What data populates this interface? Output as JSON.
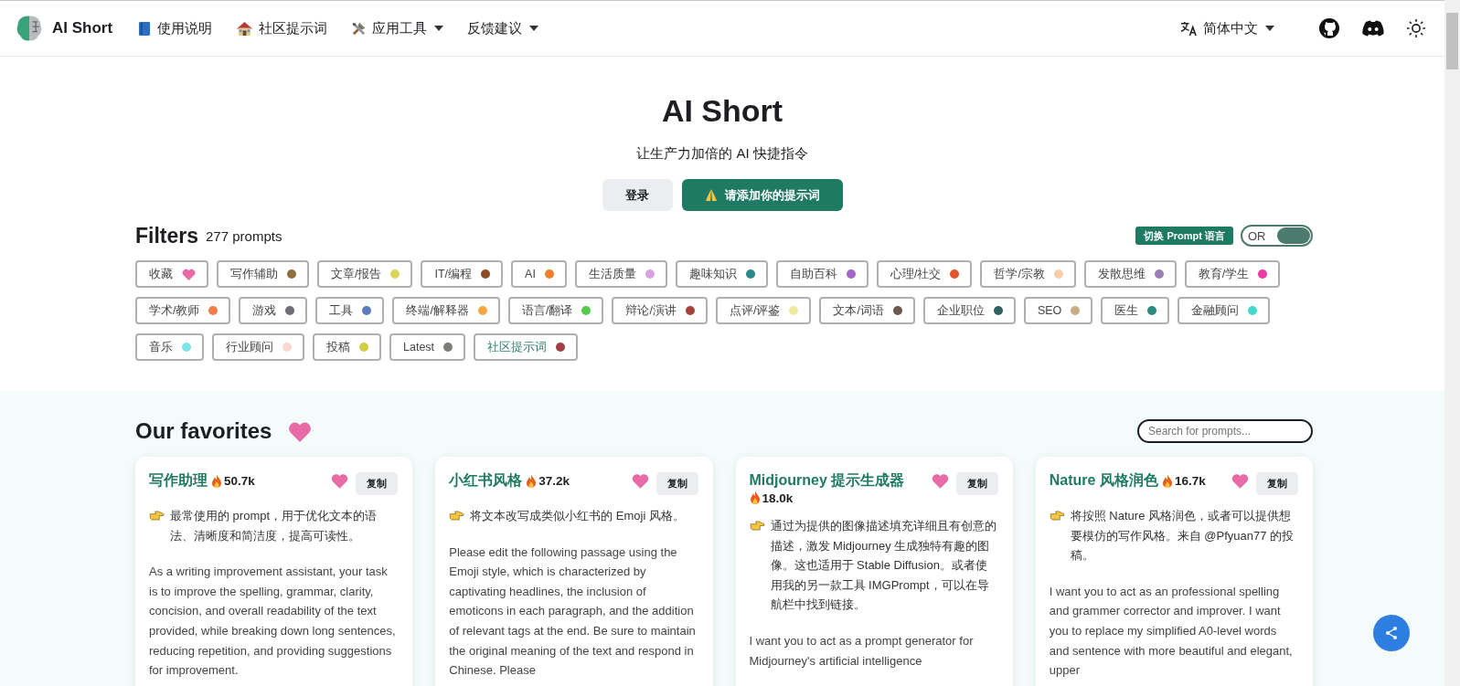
{
  "nav": {
    "brand": "AI Short",
    "links": [
      {
        "label": "使用说明",
        "kind": "book",
        "dropdown": false
      },
      {
        "label": "社区提示词",
        "kind": "house",
        "dropdown": false
      },
      {
        "label": "应用工具",
        "kind": "tools",
        "dropdown": true
      },
      {
        "label": "反馈建议",
        "kind": "plain",
        "dropdown": true
      }
    ],
    "language": "简体中文"
  },
  "hero": {
    "title": "AI Short",
    "subtitle": "让生产力加倍的 AI 快捷指令",
    "login": "登录",
    "add": "请添加你的提示词"
  },
  "filters": {
    "title": "Filters",
    "count": "277 prompts",
    "language_button": "切换 Prompt 语言",
    "mode": {
      "label": "OR",
      "on": true
    },
    "tags": [
      {
        "label": "收藏",
        "kind": "favorite",
        "color": "#e86aa6"
      },
      {
        "label": "写作辅助",
        "kind": "tag",
        "color": "#8f6f3d"
      },
      {
        "label": "文章/报告",
        "kind": "tag",
        "color": "#d9d55b"
      },
      {
        "label": "IT/编程",
        "kind": "tag",
        "color": "#8c4a25"
      },
      {
        "label": "AI",
        "kind": "tag",
        "color": "#f07f2b"
      },
      {
        "label": "生活质量",
        "kind": "tag",
        "color": "#d6a3e0"
      },
      {
        "label": "趣味知识",
        "kind": "tag",
        "color": "#2a8a8a"
      },
      {
        "label": "自助百科",
        "kind": "tag",
        "color": "#a565c4"
      },
      {
        "label": "心理/社交",
        "kind": "tag",
        "color": "#e4532b"
      },
      {
        "label": "哲学/宗教",
        "kind": "tag",
        "color": "#f9cfa8"
      },
      {
        "label": "发散思维",
        "kind": "tag",
        "color": "#9a7fb0"
      },
      {
        "label": "教育/学生",
        "kind": "tag",
        "color": "#ee3aa5"
      },
      {
        "label": "学术/教师",
        "kind": "tag",
        "color": "#f07d4a"
      },
      {
        "label": "游戏",
        "kind": "tag",
        "color": "#716a78"
      },
      {
        "label": "工具",
        "kind": "tag",
        "color": "#5b7dbd"
      },
      {
        "label": "终端/解释器",
        "kind": "tag",
        "color": "#f5a742"
      },
      {
        "label": "语言/翻译",
        "kind": "tag",
        "color": "#55c94c"
      },
      {
        "label": "辩论/演讲",
        "kind": "tag",
        "color": "#a8403a"
      },
      {
        "label": "点评/评鉴",
        "kind": "tag",
        "color": "#eeeb9f"
      },
      {
        "label": "文本/词语",
        "kind": "tag",
        "color": "#6c5a4c"
      },
      {
        "label": "企业职位",
        "kind": "tag",
        "color": "#2f6262"
      },
      {
        "label": "SEO",
        "kind": "tag",
        "color": "#c9ab87"
      },
      {
        "label": "医生",
        "kind": "tag",
        "color": "#2a8a80"
      },
      {
        "label": "金融顾问",
        "kind": "tag",
        "color": "#44d8ca"
      },
      {
        "label": "音乐",
        "kind": "tag",
        "color": "#7ee6e6"
      },
      {
        "label": "行业顾问",
        "kind": "tag",
        "color": "#fcd7d0"
      },
      {
        "label": "投稿",
        "kind": "tag",
        "color": "#d4cc44"
      },
      {
        "label": "Latest",
        "kind": "tag",
        "color": "#7d7d78"
      },
      {
        "label": "社区提示词",
        "kind": "community",
        "color": "#a13f44"
      }
    ]
  },
  "favorites": {
    "title": "Our favorites",
    "search": {
      "placeholder": "Search for prompts..."
    },
    "cards": [
      {
        "title": "写作助理",
        "hot": "50.7k",
        "copy": "复制",
        "description": "最常使用的 prompt，用于优化文本的语法、清晰度和简洁度，提高可读性。",
        "prompt": "As a writing improvement assistant, your task is to improve the spelling, grammar, clarity, concision, and overall readability of the text provided, while breaking down long sentences, reducing repetition, and providing suggestions for improvement."
      },
      {
        "title": "小红书风格",
        "hot": "37.2k",
        "copy": "复制",
        "description": "将文本改写成类似小红书的 Emoji 风格。",
        "prompt": "Please edit the following passage using the Emoji style, which is characterized by captivating headlines, the inclusion of emoticons in each paragraph, and the addition of relevant tags at the end. Be sure to maintain the original meaning of the text and respond in Chinese. Please"
      },
      {
        "title": "Midjourney 提示生成器",
        "hot": "18.0k",
        "copy": "复制",
        "description": "通过为提供的图像描述填充详细且有创意的描述，激发 Midjourney 生成独特有趣的图像。这也适用于 Stable Diffusion。或者使用我的另一款工具 IMGPrompt，可以在导航栏中找到链接。",
        "prompt": "I want you to act as a prompt generator for Midjourney's artificial intelligence"
      },
      {
        "title": "Nature 风格润色",
        "hot": "16.7k",
        "copy": "复制",
        "description": "将按照 Nature 风格润色，或者可以提供想要模仿的写作风格。来自 @Pfyuan77 的投稿。",
        "prompt": "I want you to act as an professional spelling and grammer corrector and improver. I want you to replace my simplified A0-level words and sentence with more beautiful and elegant, upper"
      }
    ]
  }
}
